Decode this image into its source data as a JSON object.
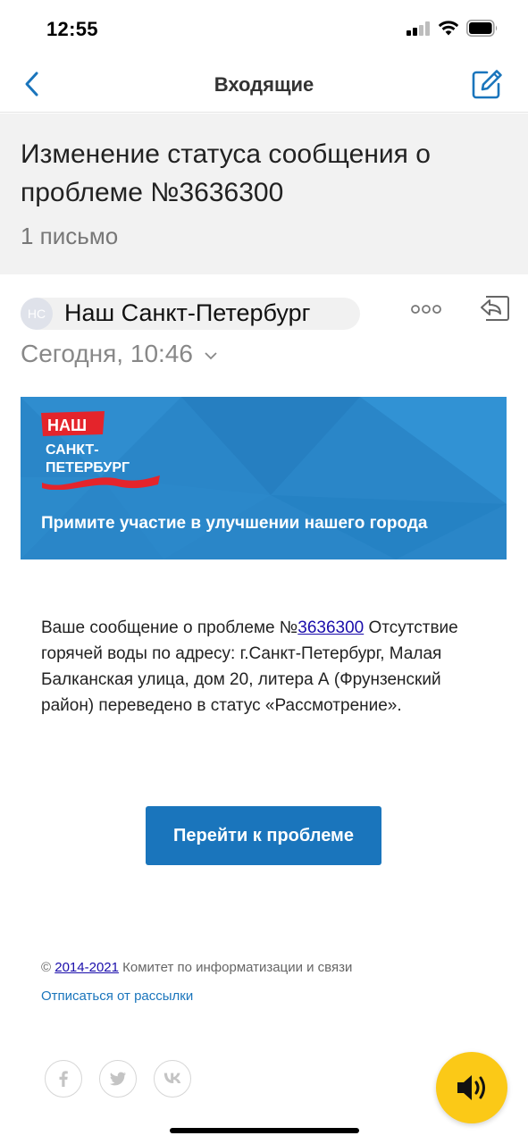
{
  "status_bar": {
    "time": "12:55"
  },
  "nav": {
    "title": "Входящие"
  },
  "thread": {
    "subject": "Изменение статуса сообщения о проблеме №3636300",
    "count": "1 письмо"
  },
  "sender": {
    "initials": "НС",
    "name": "Наш Санкт-Петербург",
    "date": "Сегодня, 10:46"
  },
  "banner": {
    "logo_line1": "НАШ",
    "logo_line2": "САНКТ-",
    "logo_line3": "ПЕТЕРБУРГ",
    "text": "Примите участие в улучшении нашего города"
  },
  "message": {
    "prefix": "Ваше сообщение о проблеме №",
    "problem_number": "3636300",
    "body": "Отсутствие горячей воды по адресу: г.Санкт-Петербург, Малая Балканская улица, дом 20, литера А (Фрунзенский район) переведено в статус «Рассмотрение»."
  },
  "cta": {
    "label": "Перейти к проблеме"
  },
  "footer": {
    "copyright_symbol": "©",
    "years": "2014-2021",
    "org": "Комитет по информатизации и связи",
    "unsubscribe": "Отписаться от рассылки"
  },
  "icons": {
    "back": "chevron-left-icon",
    "compose": "compose-icon",
    "more": "more-dots-icon",
    "reply": "reply-icon",
    "social": [
      "facebook-icon",
      "twitter-icon",
      "vk-icon"
    ],
    "audio": "speaker-icon"
  },
  "colors": {
    "accent": "#1a75bc",
    "banner": "#2a86c8",
    "audio_button": "#fbc917",
    "logo_red": "#e4242b"
  }
}
